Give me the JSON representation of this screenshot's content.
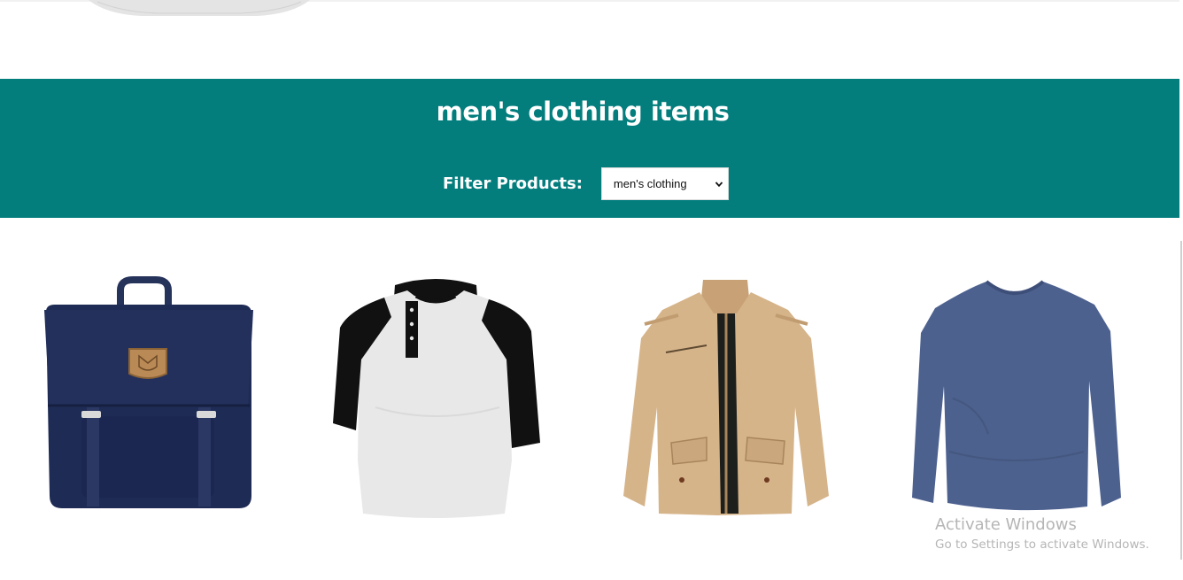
{
  "banner": {
    "title": "men's clothing items",
    "filter_label": "Filter Products:",
    "filter_selected": "men's clothing",
    "background_color": "#047d7d"
  },
  "products": [
    {
      "icon": "backpack-image"
    },
    {
      "icon": "raglan-henley-shirt-image"
    },
    {
      "icon": "beige-jacket-image"
    },
    {
      "icon": "blue-long-sleeve-shirt-image"
    }
  ],
  "watermark": {
    "title": "Activate Windows",
    "subtitle": "Go to Settings to activate Windows."
  }
}
